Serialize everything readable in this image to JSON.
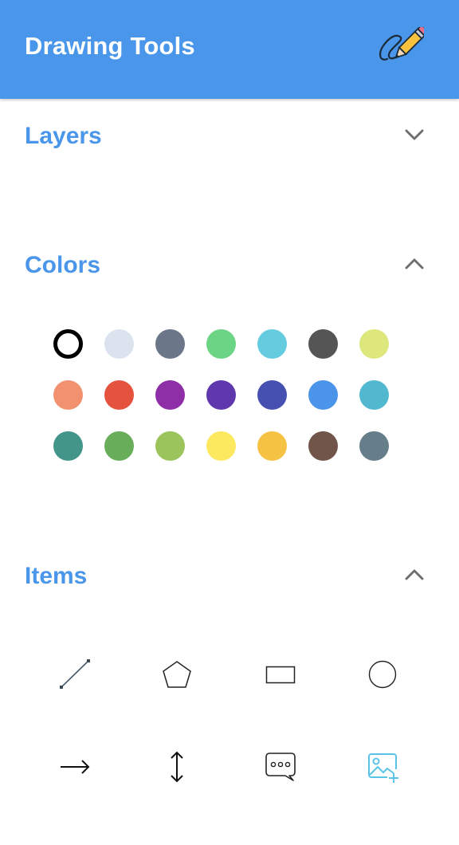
{
  "header": {
    "title": "Drawing Tools",
    "icon": "pencil-scribble-icon"
  },
  "sections": {
    "layers": {
      "title": "Layers",
      "expanded": false,
      "icon": "chevron-down-icon"
    },
    "colors": {
      "title": "Colors",
      "expanded": true,
      "icon": "chevron-up-icon"
    },
    "items": {
      "title": "Items",
      "expanded": true,
      "icon": "chevron-up-icon"
    }
  },
  "colors": {
    "selected_index": 0,
    "swatches": [
      "#ffffff",
      "#dbe3ef",
      "#6b7789",
      "#6bd585",
      "#65cbdf",
      "#555555",
      "#dde77c",
      "#f19170",
      "#e5533f",
      "#8e2fa8",
      "#5f38ad",
      "#4650b0",
      "#4a94e9",
      "#52b8d0",
      "#43958a",
      "#67ad5a",
      "#9bc45c",
      "#fce960",
      "#f6c244",
      "#71554a",
      "#667d8a"
    ]
  },
  "items": {
    "tools": [
      {
        "name": "line-tool",
        "icon": "line-icon"
      },
      {
        "name": "polygon-tool",
        "icon": "pentagon-icon"
      },
      {
        "name": "rectangle-tool",
        "icon": "rectangle-icon"
      },
      {
        "name": "circle-tool",
        "icon": "circle-icon"
      },
      {
        "name": "arrow-tool",
        "icon": "arrow-right-icon"
      },
      {
        "name": "vertical-arrow-tool",
        "icon": "arrow-up-down-icon"
      },
      {
        "name": "comment-tool",
        "icon": "speech-bubble-icon"
      },
      {
        "name": "image-tool",
        "icon": "add-image-icon"
      }
    ]
  }
}
